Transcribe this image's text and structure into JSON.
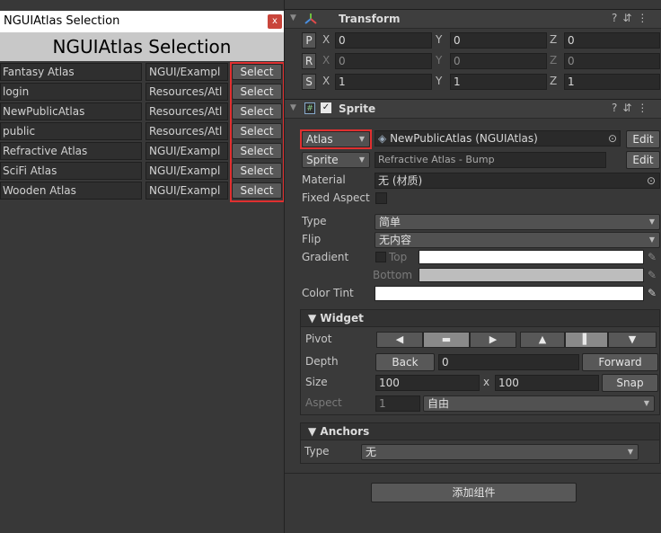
{
  "atlas_window": {
    "title": "NGUIAtlas Selection",
    "close_label": "x",
    "heading": "NGUIAtlas Selection",
    "rows": [
      {
        "name": "Fantasy Atlas",
        "path": "NGUI/Exampl",
        "button": "Select"
      },
      {
        "name": "login",
        "path": "Resources/Atl",
        "button": "Select"
      },
      {
        "name": "NewPublicAtlas",
        "path": "Resources/Atl",
        "button": "Select"
      },
      {
        "name": "public",
        "path": "Resources/Atl",
        "button": "Select"
      },
      {
        "name": "Refractive Atlas",
        "path": "NGUI/Exampl",
        "button": "Select"
      },
      {
        "name": "SciFi Atlas",
        "path": "NGUI/Exampl",
        "button": "Select"
      },
      {
        "name": "Wooden Atlas",
        "path": "NGUI/Exampl",
        "button": "Select"
      }
    ],
    "highlight_color": "#e03030"
  },
  "transform": {
    "title": "Transform",
    "rows": [
      {
        "button": "P",
        "x": "0",
        "y": "0",
        "z": "0"
      },
      {
        "button": "R",
        "x": "0",
        "y": "0",
        "z": "0"
      },
      {
        "button": "S",
        "x": "1",
        "y": "1",
        "z": "1"
      }
    ],
    "axes": {
      "x": "X",
      "y": "Y",
      "z": "Z"
    }
  },
  "sprite": {
    "title": "Sprite",
    "atlas_dropdown": "Atlas",
    "atlas_value": "NewPublicAtlas (NGUIAtlas)",
    "edit_label": "Edit",
    "sprite_dropdown": "Sprite",
    "sprite_value": "Refractive Atlas - Bump",
    "material_label": "Material",
    "material_value": "无 (材质)",
    "fixed_aspect_label": "Fixed Aspect",
    "type_label": "Type",
    "type_value": "简单",
    "flip_label": "Flip",
    "flip_value": "无内容",
    "gradient_label": "Gradient",
    "gradient_top": "Top",
    "gradient_bottom": "Bottom",
    "color_tint_label": "Color Tint"
  },
  "widget": {
    "title": "Widget",
    "pivot_label": "Pivot",
    "depth_label": "Depth",
    "back_label": "Back",
    "depth_value": "0",
    "forward_label": "Forward",
    "size_label": "Size",
    "width": "100",
    "times": "x",
    "height": "100",
    "snap_label": "Snap",
    "aspect_label": "Aspect",
    "aspect_value": "1",
    "aspect_mode": "自由"
  },
  "anchors": {
    "title": "Anchors",
    "type_label": "Type",
    "type_value": "无"
  },
  "add_component_label": "添加组件"
}
